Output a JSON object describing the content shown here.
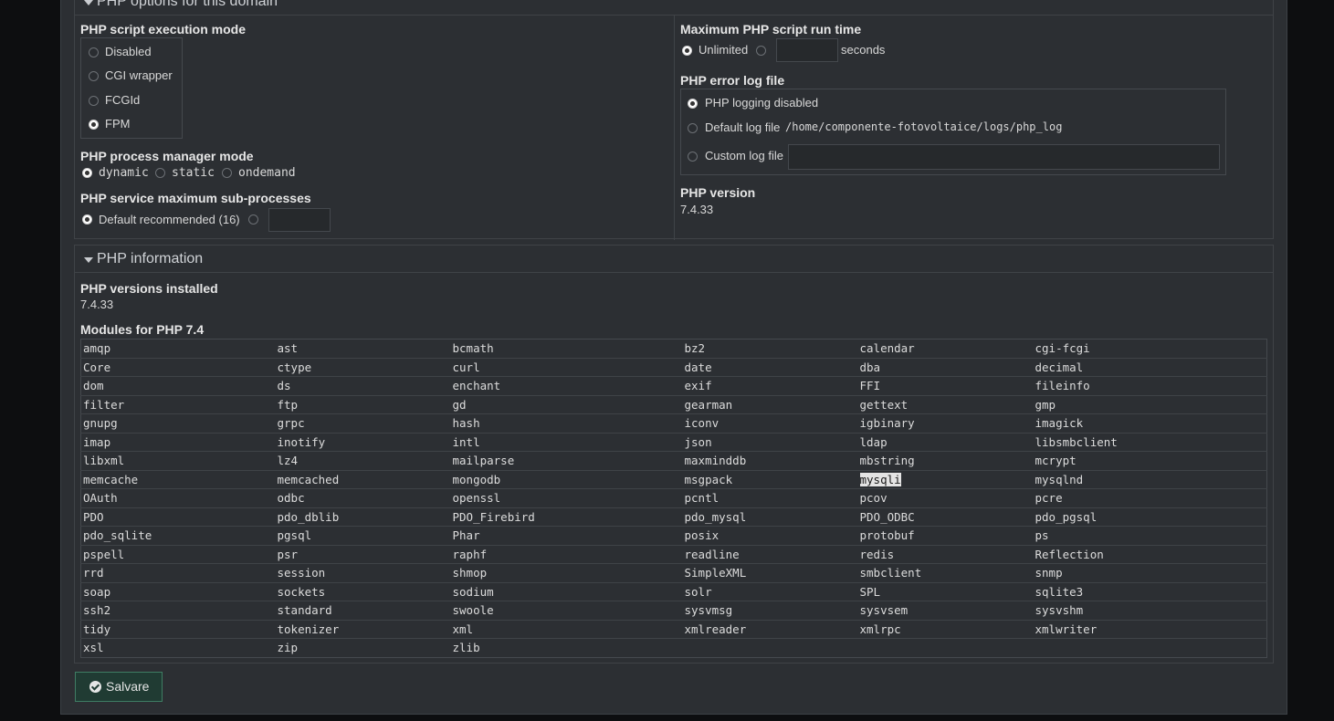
{
  "options": {
    "section_title": "PHP options for this domain",
    "exec_mode": {
      "label": "PHP script execution mode",
      "options": [
        "Disabled",
        "CGI wrapper",
        "FCGId",
        "FPM"
      ],
      "selected": "FPM"
    },
    "pm_mode": {
      "label": "PHP process manager mode",
      "options": [
        "dynamic",
        "static",
        "ondemand"
      ],
      "selected": "dynamic"
    },
    "subproc": {
      "label": "PHP service maximum sub-processes",
      "default_label": "Default recommended (16)",
      "value": ""
    },
    "runtime": {
      "label": "Maximum PHP script run time",
      "unlimited": "Unlimited",
      "seconds": "seconds",
      "value": ""
    },
    "errlog": {
      "label": "PHP error log file",
      "disabled": "PHP logging disabled",
      "default": "Default log file",
      "default_path": "/home/componente-fotovoltaice/logs/php_log",
      "custom": "Custom log file",
      "custom_value": ""
    },
    "version": {
      "label": "PHP version",
      "value": "7.4.33"
    }
  },
  "info": {
    "section_title": "PHP information",
    "installed_label": "PHP versions installed",
    "installed_value": "7.4.33",
    "modules_label": "Modules for PHP 7.4",
    "highlighted": "mysqli",
    "modules": [
      [
        "amqp",
        "ast",
        "bcmath",
        "bz2",
        "calendar",
        "cgi-fcgi"
      ],
      [
        "Core",
        "ctype",
        "curl",
        "date",
        "dba",
        "decimal"
      ],
      [
        "dom",
        "ds",
        "enchant",
        "exif",
        "FFI",
        "fileinfo"
      ],
      [
        "filter",
        "ftp",
        "gd",
        "gearman",
        "gettext",
        "gmp"
      ],
      [
        "gnupg",
        "grpc",
        "hash",
        "iconv",
        "igbinary",
        "imagick"
      ],
      [
        "imap",
        "inotify",
        "intl",
        "json",
        "ldap",
        "libsmbclient"
      ],
      [
        "libxml",
        "lz4",
        "mailparse",
        "maxminddb",
        "mbstring",
        "mcrypt"
      ],
      [
        "memcache",
        "memcached",
        "mongodb",
        "msgpack",
        "mysqli",
        "mysqlnd"
      ],
      [
        "OAuth",
        "odbc",
        "openssl",
        "pcntl",
        "pcov",
        "pcre"
      ],
      [
        "PDO",
        "pdo_dblib",
        "PDO_Firebird",
        "pdo_mysql",
        "PDO_ODBC",
        "pdo_pgsql"
      ],
      [
        "pdo_sqlite",
        "pgsql",
        "Phar",
        "posix",
        "protobuf",
        "ps"
      ],
      [
        "pspell",
        "psr",
        "raphf",
        "readline",
        "redis",
        "Reflection"
      ],
      [
        "rrd",
        "session",
        "shmop",
        "SimpleXML",
        "smbclient",
        "snmp"
      ],
      [
        "soap",
        "sockets",
        "sodium",
        "solr",
        "SPL",
        "sqlite3"
      ],
      [
        "ssh2",
        "standard",
        "swoole",
        "sysvmsg",
        "sysvsem",
        "sysvshm"
      ],
      [
        "tidy",
        "tokenizer",
        "xml",
        "xmlreader",
        "xmlrpc",
        "xmlwriter"
      ],
      [
        "xsl",
        "zip",
        "zlib",
        "",
        "",
        ""
      ]
    ]
  },
  "save_button": "Salvare"
}
